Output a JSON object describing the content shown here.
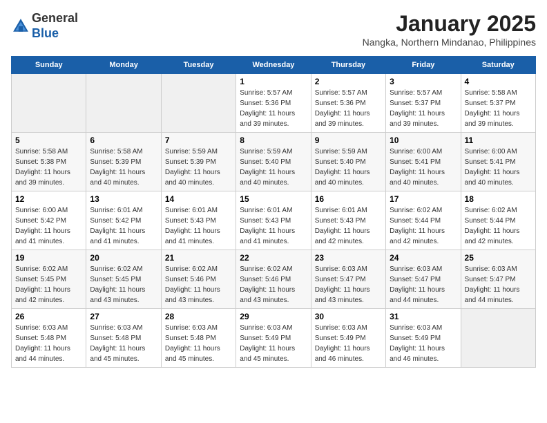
{
  "header": {
    "logo_line1": "General",
    "logo_line2": "Blue",
    "month": "January 2025",
    "location": "Nangka, Northern Mindanao, Philippines"
  },
  "weekdays": [
    "Sunday",
    "Monday",
    "Tuesday",
    "Wednesday",
    "Thursday",
    "Friday",
    "Saturday"
  ],
  "weeks": [
    [
      {
        "day": "",
        "sunrise": "",
        "sunset": "",
        "daylight": "",
        "empty": true
      },
      {
        "day": "",
        "sunrise": "",
        "sunset": "",
        "daylight": "",
        "empty": true
      },
      {
        "day": "",
        "sunrise": "",
        "sunset": "",
        "daylight": "",
        "empty": true
      },
      {
        "day": "1",
        "sunrise": "Sunrise: 5:57 AM",
        "sunset": "Sunset: 5:36 PM",
        "daylight": "Daylight: 11 hours and 39 minutes.",
        "empty": false
      },
      {
        "day": "2",
        "sunrise": "Sunrise: 5:57 AM",
        "sunset": "Sunset: 5:36 PM",
        "daylight": "Daylight: 11 hours and 39 minutes.",
        "empty": false
      },
      {
        "day": "3",
        "sunrise": "Sunrise: 5:57 AM",
        "sunset": "Sunset: 5:37 PM",
        "daylight": "Daylight: 11 hours and 39 minutes.",
        "empty": false
      },
      {
        "day": "4",
        "sunrise": "Sunrise: 5:58 AM",
        "sunset": "Sunset: 5:37 PM",
        "daylight": "Daylight: 11 hours and 39 minutes.",
        "empty": false
      }
    ],
    [
      {
        "day": "5",
        "sunrise": "Sunrise: 5:58 AM",
        "sunset": "Sunset: 5:38 PM",
        "daylight": "Daylight: 11 hours and 39 minutes.",
        "empty": false
      },
      {
        "day": "6",
        "sunrise": "Sunrise: 5:58 AM",
        "sunset": "Sunset: 5:39 PM",
        "daylight": "Daylight: 11 hours and 40 minutes.",
        "empty": false
      },
      {
        "day": "7",
        "sunrise": "Sunrise: 5:59 AM",
        "sunset": "Sunset: 5:39 PM",
        "daylight": "Daylight: 11 hours and 40 minutes.",
        "empty": false
      },
      {
        "day": "8",
        "sunrise": "Sunrise: 5:59 AM",
        "sunset": "Sunset: 5:40 PM",
        "daylight": "Daylight: 11 hours and 40 minutes.",
        "empty": false
      },
      {
        "day": "9",
        "sunrise": "Sunrise: 5:59 AM",
        "sunset": "Sunset: 5:40 PM",
        "daylight": "Daylight: 11 hours and 40 minutes.",
        "empty": false
      },
      {
        "day": "10",
        "sunrise": "Sunrise: 6:00 AM",
        "sunset": "Sunset: 5:41 PM",
        "daylight": "Daylight: 11 hours and 40 minutes.",
        "empty": false
      },
      {
        "day": "11",
        "sunrise": "Sunrise: 6:00 AM",
        "sunset": "Sunset: 5:41 PM",
        "daylight": "Daylight: 11 hours and 40 minutes.",
        "empty": false
      }
    ],
    [
      {
        "day": "12",
        "sunrise": "Sunrise: 6:00 AM",
        "sunset": "Sunset: 5:42 PM",
        "daylight": "Daylight: 11 hours and 41 minutes.",
        "empty": false
      },
      {
        "day": "13",
        "sunrise": "Sunrise: 6:01 AM",
        "sunset": "Sunset: 5:42 PM",
        "daylight": "Daylight: 11 hours and 41 minutes.",
        "empty": false
      },
      {
        "day": "14",
        "sunrise": "Sunrise: 6:01 AM",
        "sunset": "Sunset: 5:43 PM",
        "daylight": "Daylight: 11 hours and 41 minutes.",
        "empty": false
      },
      {
        "day": "15",
        "sunrise": "Sunrise: 6:01 AM",
        "sunset": "Sunset: 5:43 PM",
        "daylight": "Daylight: 11 hours and 41 minutes.",
        "empty": false
      },
      {
        "day": "16",
        "sunrise": "Sunrise: 6:01 AM",
        "sunset": "Sunset: 5:43 PM",
        "daylight": "Daylight: 11 hours and 42 minutes.",
        "empty": false
      },
      {
        "day": "17",
        "sunrise": "Sunrise: 6:02 AM",
        "sunset": "Sunset: 5:44 PM",
        "daylight": "Daylight: 11 hours and 42 minutes.",
        "empty": false
      },
      {
        "day": "18",
        "sunrise": "Sunrise: 6:02 AM",
        "sunset": "Sunset: 5:44 PM",
        "daylight": "Daylight: 11 hours and 42 minutes.",
        "empty": false
      }
    ],
    [
      {
        "day": "19",
        "sunrise": "Sunrise: 6:02 AM",
        "sunset": "Sunset: 5:45 PM",
        "daylight": "Daylight: 11 hours and 42 minutes.",
        "empty": false
      },
      {
        "day": "20",
        "sunrise": "Sunrise: 6:02 AM",
        "sunset": "Sunset: 5:45 PM",
        "daylight": "Daylight: 11 hours and 43 minutes.",
        "empty": false
      },
      {
        "day": "21",
        "sunrise": "Sunrise: 6:02 AM",
        "sunset": "Sunset: 5:46 PM",
        "daylight": "Daylight: 11 hours and 43 minutes.",
        "empty": false
      },
      {
        "day": "22",
        "sunrise": "Sunrise: 6:02 AM",
        "sunset": "Sunset: 5:46 PM",
        "daylight": "Daylight: 11 hours and 43 minutes.",
        "empty": false
      },
      {
        "day": "23",
        "sunrise": "Sunrise: 6:03 AM",
        "sunset": "Sunset: 5:47 PM",
        "daylight": "Daylight: 11 hours and 43 minutes.",
        "empty": false
      },
      {
        "day": "24",
        "sunrise": "Sunrise: 6:03 AM",
        "sunset": "Sunset: 5:47 PM",
        "daylight": "Daylight: 11 hours and 44 minutes.",
        "empty": false
      },
      {
        "day": "25",
        "sunrise": "Sunrise: 6:03 AM",
        "sunset": "Sunset: 5:47 PM",
        "daylight": "Daylight: 11 hours and 44 minutes.",
        "empty": false
      }
    ],
    [
      {
        "day": "26",
        "sunrise": "Sunrise: 6:03 AM",
        "sunset": "Sunset: 5:48 PM",
        "daylight": "Daylight: 11 hours and 44 minutes.",
        "empty": false
      },
      {
        "day": "27",
        "sunrise": "Sunrise: 6:03 AM",
        "sunset": "Sunset: 5:48 PM",
        "daylight": "Daylight: 11 hours and 45 minutes.",
        "empty": false
      },
      {
        "day": "28",
        "sunrise": "Sunrise: 6:03 AM",
        "sunset": "Sunset: 5:48 PM",
        "daylight": "Daylight: 11 hours and 45 minutes.",
        "empty": false
      },
      {
        "day": "29",
        "sunrise": "Sunrise: 6:03 AM",
        "sunset": "Sunset: 5:49 PM",
        "daylight": "Daylight: 11 hours and 45 minutes.",
        "empty": false
      },
      {
        "day": "30",
        "sunrise": "Sunrise: 6:03 AM",
        "sunset": "Sunset: 5:49 PM",
        "daylight": "Daylight: 11 hours and 46 minutes.",
        "empty": false
      },
      {
        "day": "31",
        "sunrise": "Sunrise: 6:03 AM",
        "sunset": "Sunset: 5:49 PM",
        "daylight": "Daylight: 11 hours and 46 minutes.",
        "empty": false
      },
      {
        "day": "",
        "sunrise": "",
        "sunset": "",
        "daylight": "",
        "empty": true
      }
    ]
  ]
}
